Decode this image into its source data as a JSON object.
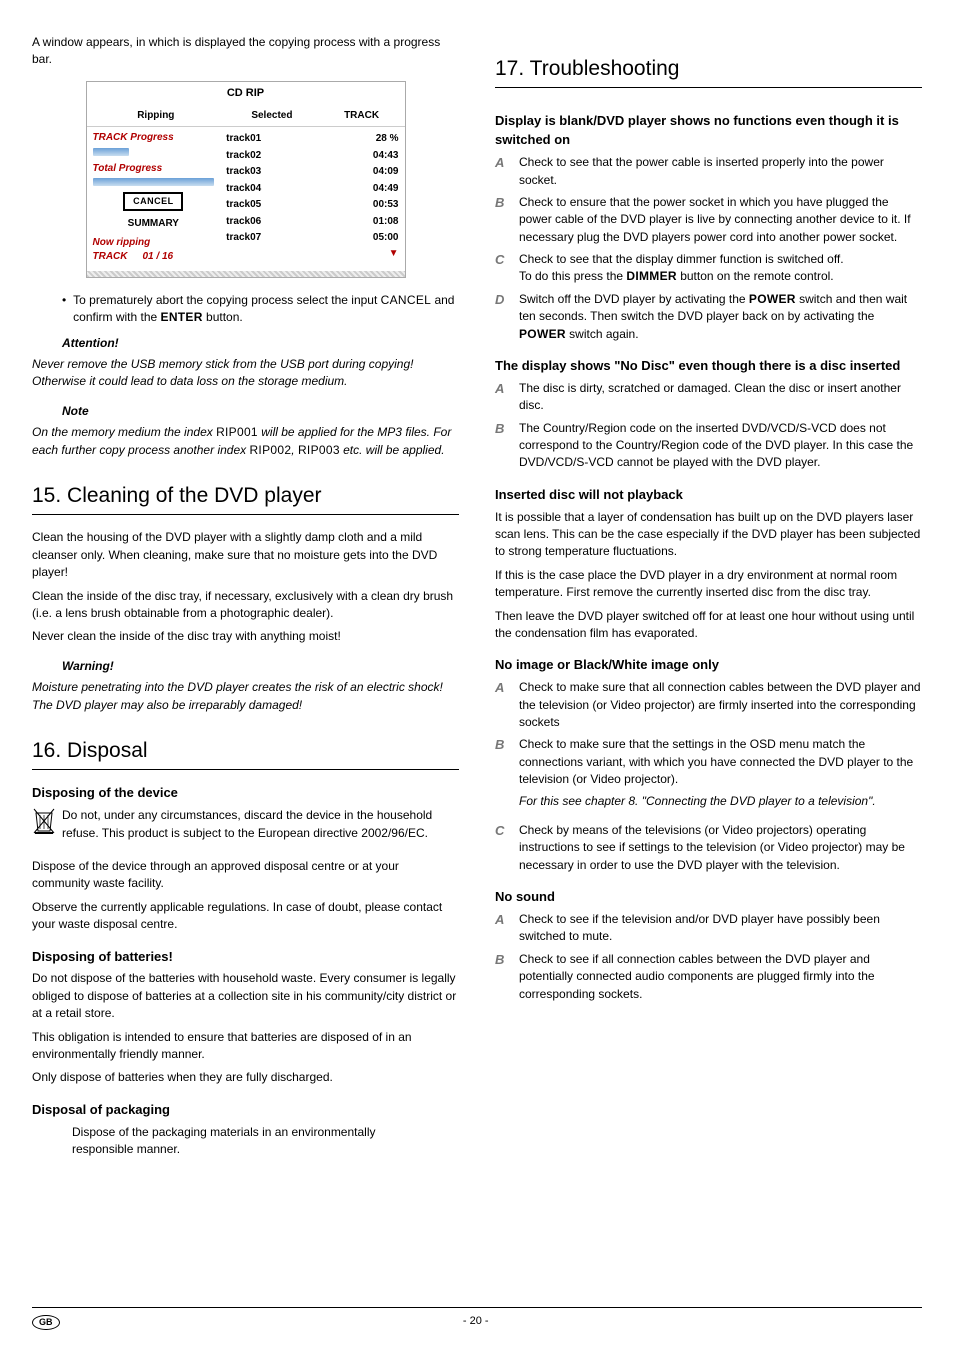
{
  "left": {
    "intro": "A window appears, in which is displayed the copying process with a progress bar.",
    "cdrip": {
      "title": "CD RIP",
      "headers": {
        "l": "Ripping",
        "m": "Selected",
        "r": "TRACK"
      },
      "track_progress_label": "TRACK Progress",
      "total_progress_label": "Total Progress",
      "cancel": "CANCEL",
      "summary": "SUMMARY",
      "now_ripping": "Now ripping",
      "track_label": "TRACK",
      "track_count": "01 / 16",
      "rows": [
        {
          "name": "track01",
          "val": "28 %"
        },
        {
          "name": "track02",
          "val": "04:43"
        },
        {
          "name": "track03",
          "val": "04:09"
        },
        {
          "name": "track04",
          "val": "04:49"
        },
        {
          "name": "track05",
          "val": "00:53"
        },
        {
          "name": "track06",
          "val": "01:08"
        },
        {
          "name": "track07",
          "val": "05:00"
        }
      ]
    },
    "bullet_text_a": "To prematurely abort the copying process select the input ",
    "bullet_cancel": "CANCEL",
    "bullet_text_b": " and confirm with the ",
    "bullet_enter": "ENTER",
    "bullet_text_c": " button.",
    "attention_title": "Attention!",
    "attention_body": "Never remove the USB memory stick from the USB port during copying! Otherwise it could lead to data loss on the storage medium.",
    "note_title": "Note",
    "note_body_a": "On the memory medium the index ",
    "note_rip1": "RIP001",
    "note_body_b": " will be applied for the MP3 files. For each further copy process another index ",
    "note_rip2": "RIP002",
    "note_rip3": "RIP003",
    "note_body_c": " etc. will be applied.",
    "h15": "15. Cleaning of the DVD player",
    "clean_p1": "Clean the housing of the DVD player with a slightly damp cloth and a mild cleanser only. When cleaning, make sure that no moisture gets into the DVD player!",
    "clean_p2": "Clean the inside of the disc tray, if necessary, exclusively with a clean dry brush (i.e. a lens brush obtainable from a photographic dealer).",
    "clean_p3": "Never clean the inside of the disc tray with anything moist!",
    "warning_title": "Warning!",
    "warning_body": "Moisture penetrating into the DVD player creates the risk of an electric shock! The DVD player may also be irreparably damaged!",
    "h16": "16. Disposal",
    "disp_device_h": "Disposing of the device",
    "disp_device_p1": "Do not, under any circumstances, discard the device in the household refuse. This product is subject to the European directive 2002/96/EC.",
    "disp_device_p2": "Dispose of the device through an approved disposal centre or at your community waste facility.",
    "disp_device_p3": "Observe the currently applicable regulations. In case of doubt, please contact your waste disposal centre.",
    "disp_batt_h": "Disposing of batteries!",
    "disp_batt_p1": "Do not dispose of the batteries with household waste. Every consumer is legally obliged to dispose of batteries at a collection site in his community/city district or at a retail store.",
    "disp_batt_p2": "This obligation is intended to ensure that batteries are disposed of in an environmentally friendly manner.",
    "disp_batt_p3": "Only dispose of batteries when they are fully discharged.",
    "disp_pack_h": "Disposal of packaging",
    "disp_pack_p": "Dispose of the packaging materials in an environmentally responsible manner."
  },
  "right": {
    "h17": "17. Troubleshooting",
    "s1_h": "Display is blank/DVD player shows no functions even though it is switched on",
    "s1_a": "Check to see that the power cable is inserted properly into the power socket.",
    "s1_b": "Check to ensure that the power socket in which you have plugged the power cable of the DVD player is live by connecting another device to it. If necessary plug the DVD players power cord into another power socket.",
    "s1_c_a": "Check to see that the display dimmer function is switched off.",
    "s1_c_b": "To do this press the ",
    "s1_c_dimmer": "DIMMER",
    "s1_c_c": " button on the remote control.",
    "s1_d_a": "Switch off the DVD player by activating the ",
    "s1_d_power1": "POWER",
    "s1_d_b": " switch and then wait ten seconds. Then switch the DVD player back on by activating the ",
    "s1_d_power2": "POWER",
    "s1_d_c": " switch again.",
    "s2_h": "The display shows \"No Disc\" even though there is a disc inserted",
    "s2_a": "The disc is dirty, scratched or damaged. Clean the disc or insert another disc.",
    "s2_b": "The Country/Region code on the inserted DVD/VCD/S-VCD does not correspond to the Country/Region code of the DVD player. In this case the DVD/VCD/S-VCD cannot be played with the DVD player.",
    "s3_h": "Inserted disc will not playback",
    "s3_p1": "It is possible that a layer of condensation has built up on the DVD players laser scan lens. This can be the case especially if the DVD player has been subjected to strong temperature fluctuations.",
    "s3_p2": "If this is the case place the DVD player in a dry environment at normal room temperature. First remove the currently inserted disc from the disc tray.",
    "s3_p3": "Then leave the DVD player switched off for at least one hour without using until the condensation film has evaporated.",
    "s4_h": "No image or Black/White image only",
    "s4_a": "Check to make sure that all connection cables between the DVD player and the television (or Video projector) are firmly inserted into the corresponding sockets",
    "s4_b": "Check to make sure that the settings in the OSD menu match the connections variant, with which you have connected the DVD player to the television (or Video projector).",
    "s4_b_it": "For this see chapter 8. \"Connecting the DVD player to a television\".",
    "s4_c": "Check by means of the televisions (or Video projectors) operating instructions to see if settings to the television (or Video projector) may be necessary in order to use the DVD player with the television.",
    "s5_h": "No sound",
    "s5_a": "Check to see if the television and/or DVD player have possibly been switched to mute.",
    "s5_b": "Check to see if all connection cables between the DVD player and potentially connected audio components are plugged firmly into the corresponding sockets."
  },
  "footer": {
    "gb": "GB",
    "page": "- 20 -"
  }
}
